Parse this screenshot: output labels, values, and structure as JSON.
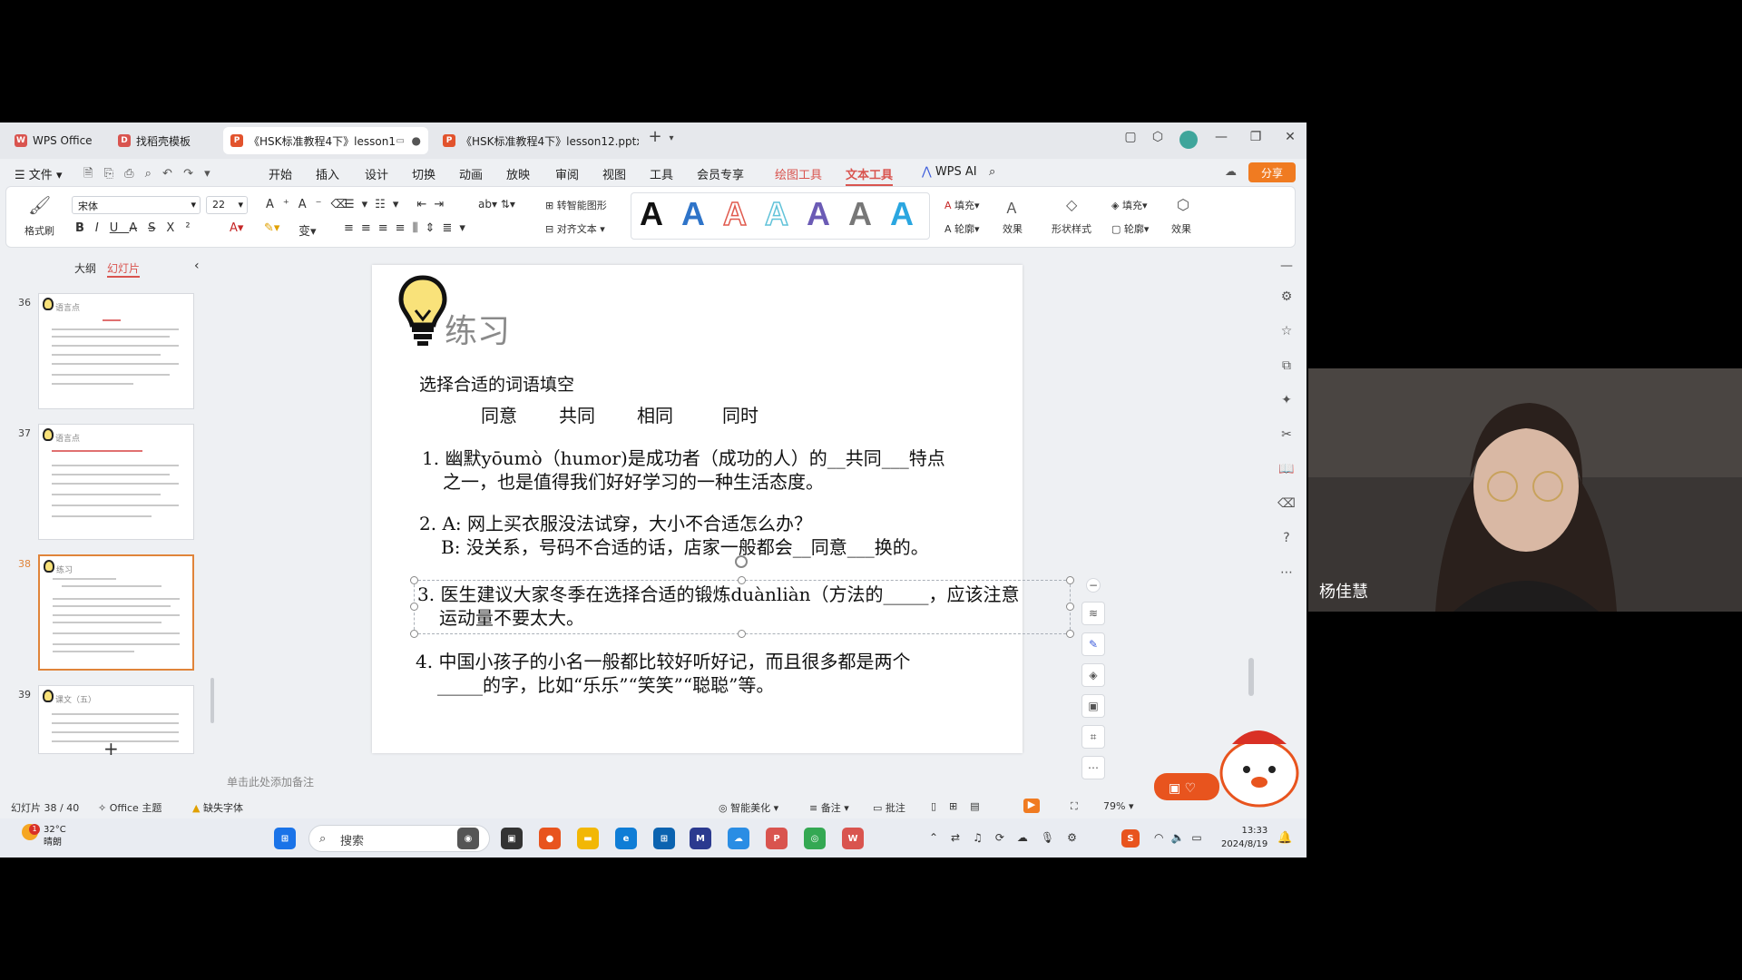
{
  "tabs": [
    {
      "label": "WPS Office",
      "color": "#d9544f"
    },
    {
      "label": "找稻壳模板",
      "color": "#d9544f"
    },
    {
      "label": "《HSK标准教程4下》lesson1",
      "color": "#e2532d"
    },
    {
      "label": "《HSK标准教程4下》lesson12.pptx",
      "color": "#e2532d"
    }
  ],
  "menu": {
    "file": "文件",
    "items": [
      "开始",
      "插入",
      "设计",
      "切换",
      "动画",
      "放映",
      "审阅",
      "视图",
      "工具",
      "会员专享"
    ],
    "drawing_tools": "绘图工具",
    "text_tools": "文本工具",
    "ai": "WPS AI",
    "share": "分享"
  },
  "ribbon": {
    "format_painter": "格式刷",
    "font_name": "宋体",
    "font_size": "22",
    "smart_shape": "转智能图形",
    "align_text": "对齐文本",
    "fill": "填充",
    "outline": "轮廓",
    "effect": "效果",
    "shape_style": "形状样式",
    "fill2": "填充",
    "outline2": "轮廓",
    "effect2": "效果",
    "text_style_colors": [
      "#111111",
      "#2e74c9",
      "#e05a4e",
      "#62c3d9",
      "#6b5bb5",
      "#777777",
      "#2aa6e0"
    ]
  },
  "pane": {
    "tab_outline": "大纲",
    "tab_slides": "幻灯片",
    "thumbs": [
      {
        "num": "36",
        "title": "语言点"
      },
      {
        "num": "37",
        "title": "语言点"
      },
      {
        "num": "38",
        "title": "练习"
      },
      {
        "num": "39",
        "title": "课文（五）"
      }
    ]
  },
  "slide": {
    "heading": "练习",
    "instruction": "选择合适的词语填空",
    "options": [
      "同意",
      "共同",
      "相同",
      "同时"
    ],
    "q1_line1": "1. 幽默yōumò（humor)是成功者（成功的人）的__共同___特点",
    "q1_line2": "之一，也是值得我们好好学习的一种生活态度。",
    "q2_line1": "2. A: 网上买衣服没法试穿，大小不合适怎么办？",
    "q2_line2": "B: 没关系，号码不合适的话，店家一般都会__同意___换的。",
    "q3_line1": "3. 医生建议大家冬季在选择合适的锻炼duànliàn（方法的_____，应该注意",
    "q3_line2": "运动量不要太大。",
    "q4_line1": "4. 中国小孩子的小名一般都比较好听好记，而且很多都是两个",
    "q4_line2": "_____的字，比如“乐乐”“笑笑”“聪聪”等。"
  },
  "notes_placeholder": "单击此处添加备注",
  "status": {
    "slide_counter": "幻灯片 38 / 40",
    "theme": "Office 主题",
    "missing_font": "缺失字体",
    "beautify": "智能美化",
    "notes": "备注",
    "comment": "批注",
    "zoom": "79%"
  },
  "taskbar": {
    "weather_temp": "32°C",
    "weather_desc": "晴朗",
    "weather_badge": "1",
    "search": "搜索",
    "time": "13:33",
    "date": "2024/8/19"
  },
  "webcam": {
    "name": "杨佳慧"
  }
}
